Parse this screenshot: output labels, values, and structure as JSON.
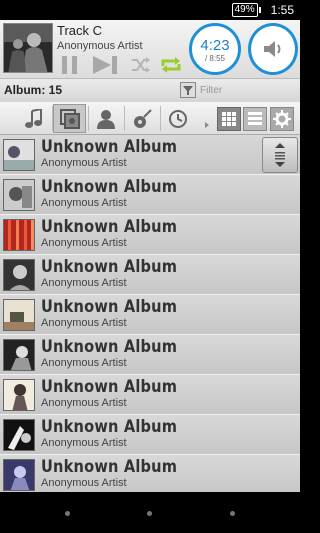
{
  "status_bar": {
    "battery": "49%",
    "time": "1:55"
  },
  "now_playing": {
    "title": "Track C",
    "artist": "Anonymous Artist",
    "elapsed": "4:23",
    "duration": "/ 8:55"
  },
  "album_bar": {
    "count_label": "Album: 15",
    "filter_label": "Filter"
  },
  "tabs": [
    {
      "icon": "music-note-icon",
      "active": false
    },
    {
      "icon": "album-icon",
      "active": true
    },
    {
      "icon": "artist-icon",
      "active": false
    },
    {
      "icon": "guitar-icon",
      "active": false
    },
    {
      "icon": "clock-icon",
      "active": false
    }
  ],
  "albums": [
    {
      "name": "Unknown Album",
      "artist": "Anonymous Artist"
    },
    {
      "name": "Unknown Album",
      "artist": "Anonymous Artist"
    },
    {
      "name": "Unknown Album",
      "artist": "Anonymous Artist"
    },
    {
      "name": "Unknown Album",
      "artist": "Anonymous Artist"
    },
    {
      "name": "Unknown Album",
      "artist": "Anonymous Artist"
    },
    {
      "name": "Unknown Album",
      "artist": "Anonymous Artist"
    },
    {
      "name": "Unknown Album",
      "artist": "Anonymous Artist"
    },
    {
      "name": "Unknown Album",
      "artist": "Anonymous Artist"
    },
    {
      "name": "Unknown Album",
      "artist": "Anonymous Artist"
    }
  ],
  "colors": {
    "accent": "#1e90d8",
    "repeat": "#9ccc2a"
  }
}
